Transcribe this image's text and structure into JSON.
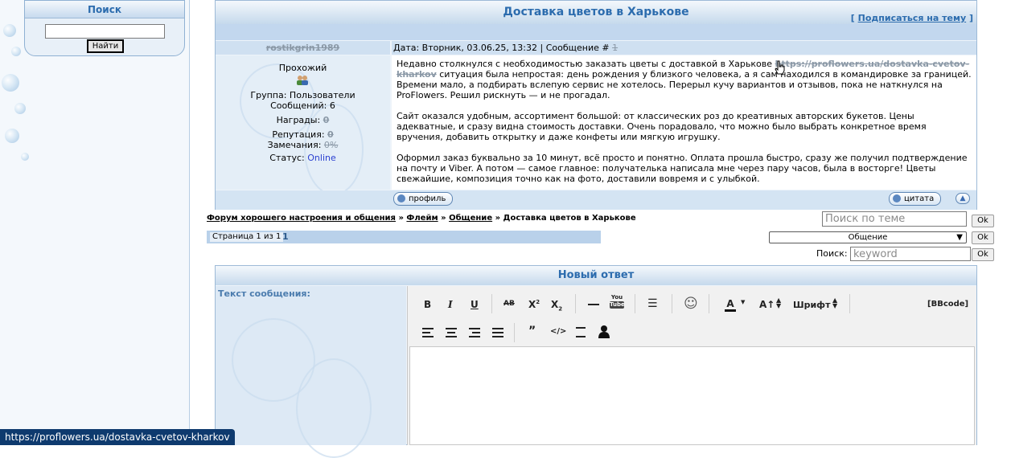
{
  "sidebar": {
    "search_title": "Поиск",
    "search_button": "Найти",
    "search_value": ""
  },
  "topic": {
    "title": "Доставка цветов в Харькове",
    "subscribe_open": "[",
    "subscribe_label": "Подписаться на тему",
    "subscribe_close": "]"
  },
  "post": {
    "author_name": "rostikgrin1989",
    "meta_prefix": "Дата: Вторник, 03.06.25, 13:32 | Сообщение #",
    "message_number": "1",
    "author_rank": "Прохожий",
    "group": "Группа: Пользователи",
    "messages_count": "Сообщений: 6",
    "awards_label": "Награды:",
    "awards_value": "0",
    "reputation_label": "Репутация:",
    "reputation_value": "0",
    "warnings_label": "Замечания:",
    "warnings_value": "0%",
    "status_label": "Статус:",
    "status_value": "Online",
    "p1_before": "Недавно столкнулся с необходимостью заказать цветы с доставкой в Харькове",
    "p1_link": "https://proflowers.ua/dostavka-cvetov-kharkov",
    "p1_after": "ситуация была непростая: день рождения у близкого человека, а я сам находился в командировке за границей. Времени мало, а подбирать вслепую сервис не хотелось. Перерыл кучу вариантов и отзывов, пока не наткнулся на ProFlowers. Решил рискнуть — и не прогадал.",
    "p2": "Сайт оказался удобным, ассортимент большой: от классических роз до креативных авторских букетов. Цены адекватные, и сразу видна стоимость доставки. Очень порадовало, что можно было выбрать конкретное время вручения, добавить открытку и даже конфеты или мягкую игрушку.",
    "p3": "Оформил заказ буквально за 10 минут, всё просто и понятно. Оплата прошла быстро, сразу же получил подтверждение на почту и Viber. А потом — самое главное: получателька написала мне через пару часов, была в восторге! Цветы свежайшие, композиция точно как на фото, доставили вовремя и с улыбкой.",
    "profile_button": "профиль",
    "quote_button": "цитата"
  },
  "breadcrumb": {
    "item1": "Форум хорошего настроения и общения",
    "sep": "»",
    "item2": "Флейм",
    "item3": "Общение",
    "current": "Доставка цветов в Харькове"
  },
  "paging": {
    "label": "Страница 1 из 1",
    "current_page": "1"
  },
  "controls": {
    "topic_search_placeholder": "Поиск по теме",
    "ok": "Ok",
    "forum_select": "Общение",
    "search_label": "Поиск:",
    "keyword_placeholder": "keyword"
  },
  "reply": {
    "title": "Новый ответ",
    "message_label": "Текст сообщения:",
    "bbcode": "[BBcode]",
    "font_label": "Шрифт",
    "youtube_top": "You",
    "youtube_bottom": "Tube"
  },
  "statusbar": {
    "url": "https://proflowers.ua/dostavka-cvetov-kharkov"
  }
}
